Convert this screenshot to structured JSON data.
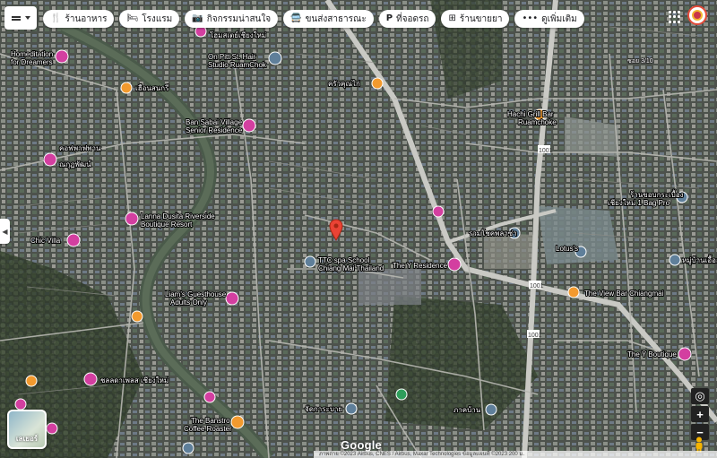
{
  "filters": [
    {
      "id": "restaurants",
      "icon": "fork-knife-icon",
      "label": "ร้านอาหาร"
    },
    {
      "id": "hotels",
      "icon": "bed-icon",
      "label": "โรงแรม"
    },
    {
      "id": "things-to-do",
      "icon": "camera-icon",
      "label": "กิจกรรมน่าสนใจ"
    },
    {
      "id": "transit",
      "icon": "bus-icon",
      "label": "ขนส่งสาธารณะ"
    },
    {
      "id": "parking",
      "icon": "parking-icon",
      "label": "ที่จอดรถ"
    },
    {
      "id": "pharmacy",
      "icon": "pharmacy-icon",
      "label": "ร้านขายยา"
    },
    {
      "id": "more",
      "icon": "more-icon",
      "label": "ดูเพิ่มเติม"
    }
  ],
  "layers_label": "เลเยอร์",
  "google_logo": "Google",
  "attribution": "ภาพถ่าย ©2023 Airbus, CNES / Airbus, Maxar Technologies ข้อมูลแผนที่ ©2023   200 ม.",
  "places": [
    {
      "name": "Homeditation Guesthouse for Dreamers",
      "lines": [
        "Homeditation",
        "for Dreamers"
      ],
      "type": "hotel"
    },
    {
      "name": "On Pitt St. Hair Studio RuamChok",
      "lines": [
        "On Pitt St. Hair",
        "Studio RuamChok"
      ],
      "type": "shop"
    },
    {
      "name": "โฮมสเตย์ เชียงใหม่",
      "lines": [
        "โฮมสเตย์เชียงใหม่"
      ],
      "type": "hotel"
    },
    {
      "name": "เฮือนสนกรี",
      "lines": [
        "เฮือนสนกรี"
      ],
      "type": "food"
    },
    {
      "name": "Ban Sabai Village Senior Residence",
      "lines": [
        "Ban Sabai Village",
        "Senior Residence"
      ],
      "type": "hotel"
    },
    {
      "name": "ครัวคุณไก่",
      "lines": [
        "ครัวคุณไก่"
      ],
      "type": "food"
    },
    {
      "name": "Hachi Grill Bar Ruamchoke",
      "lines": [
        "Hachi Grill Bar",
        "Ruamchoke"
      ],
      "type": "food"
    },
    {
      "name": "คอฟพาฟพาน ณ กุฏพัฒน์",
      "lines": [
        "คอฟพาฟพาน",
        "ณกุฏพัฒน์"
      ],
      "type": "hotel"
    },
    {
      "name": "Lanna Dusita Riverside Boutique Resort",
      "lines": [
        "Lanna Dusita Riverside",
        "Boutique Resort"
      ],
      "type": "hotel"
    },
    {
      "name": "Chic Villa",
      "lines": [
        "Chic Villa"
      ],
      "type": "hotel"
    },
    {
      "name": "TTC spa School Chiang Mai Thailand",
      "lines": [
        "TTC spa School",
        "Chiang Mai Thailand"
      ],
      "type": "shop"
    },
    {
      "name": "The Y Residence",
      "lines": [
        "The Y Residence"
      ],
      "type": "hotel"
    },
    {
      "name": "รวมโชคพลาซ่า",
      "lines": [
        "รวมโชคพลาซ่า"
      ],
      "type": "shop"
    },
    {
      "name": "Liam's Guesthouse Adults Only",
      "lines": [
        "Liam's Guesthouse",
        "Adults Only"
      ],
      "type": "hotel"
    },
    {
      "name": "The View Bar Chiangmai",
      "lines": [
        "The View Bar Chiangmai"
      ],
      "type": "food"
    },
    {
      "name": "The Y Boutique",
      "lines": [
        "The Y Boutique"
      ],
      "type": "hotel"
    },
    {
      "name": "Lotus's",
      "lines": [
        "Lotus's"
      ],
      "type": "shop"
    },
    {
      "name": "The Banstro Coffee Roaster",
      "lines": [
        "The Banstro",
        "Coffee Roaster"
      ],
      "type": "food"
    },
    {
      "name": "หมู่บ้านเอื้ออารี",
      "lines": [
        "หมู่บ้านเอื้ออารี"
      ],
      "type": "shop"
    },
    {
      "name": "ร้านขอบกระเบื้อง เชียงใหม่",
      "lines": [
        "ร้านขอบกระเบื้อง",
        "เชียงใหม่ 1 Bag Pro"
      ],
      "type": "shop"
    },
    {
      "name": "ชลลดาเพลส เชียงใหม่",
      "lines": [
        "ชลลดาเพลส เชียงใหม่"
      ],
      "type": "hotel"
    },
    {
      "name": "ภาคบ้าน",
      "lines": [
        "ภาคบ้าน"
      ],
      "type": "shop"
    },
    {
      "name": "จัดการะบาย",
      "lines": [
        "จัดการะบาย"
      ],
      "type": "shop"
    }
  ],
  "road_labels": [
    "1001",
    "1001",
    "1001",
    "1001",
    "ซอย 3/10"
  ],
  "colors": {
    "hotel": "#d33fa0",
    "food": "#f29a2e",
    "shop": "#5f7f9a",
    "pin": "#ea4335"
  }
}
